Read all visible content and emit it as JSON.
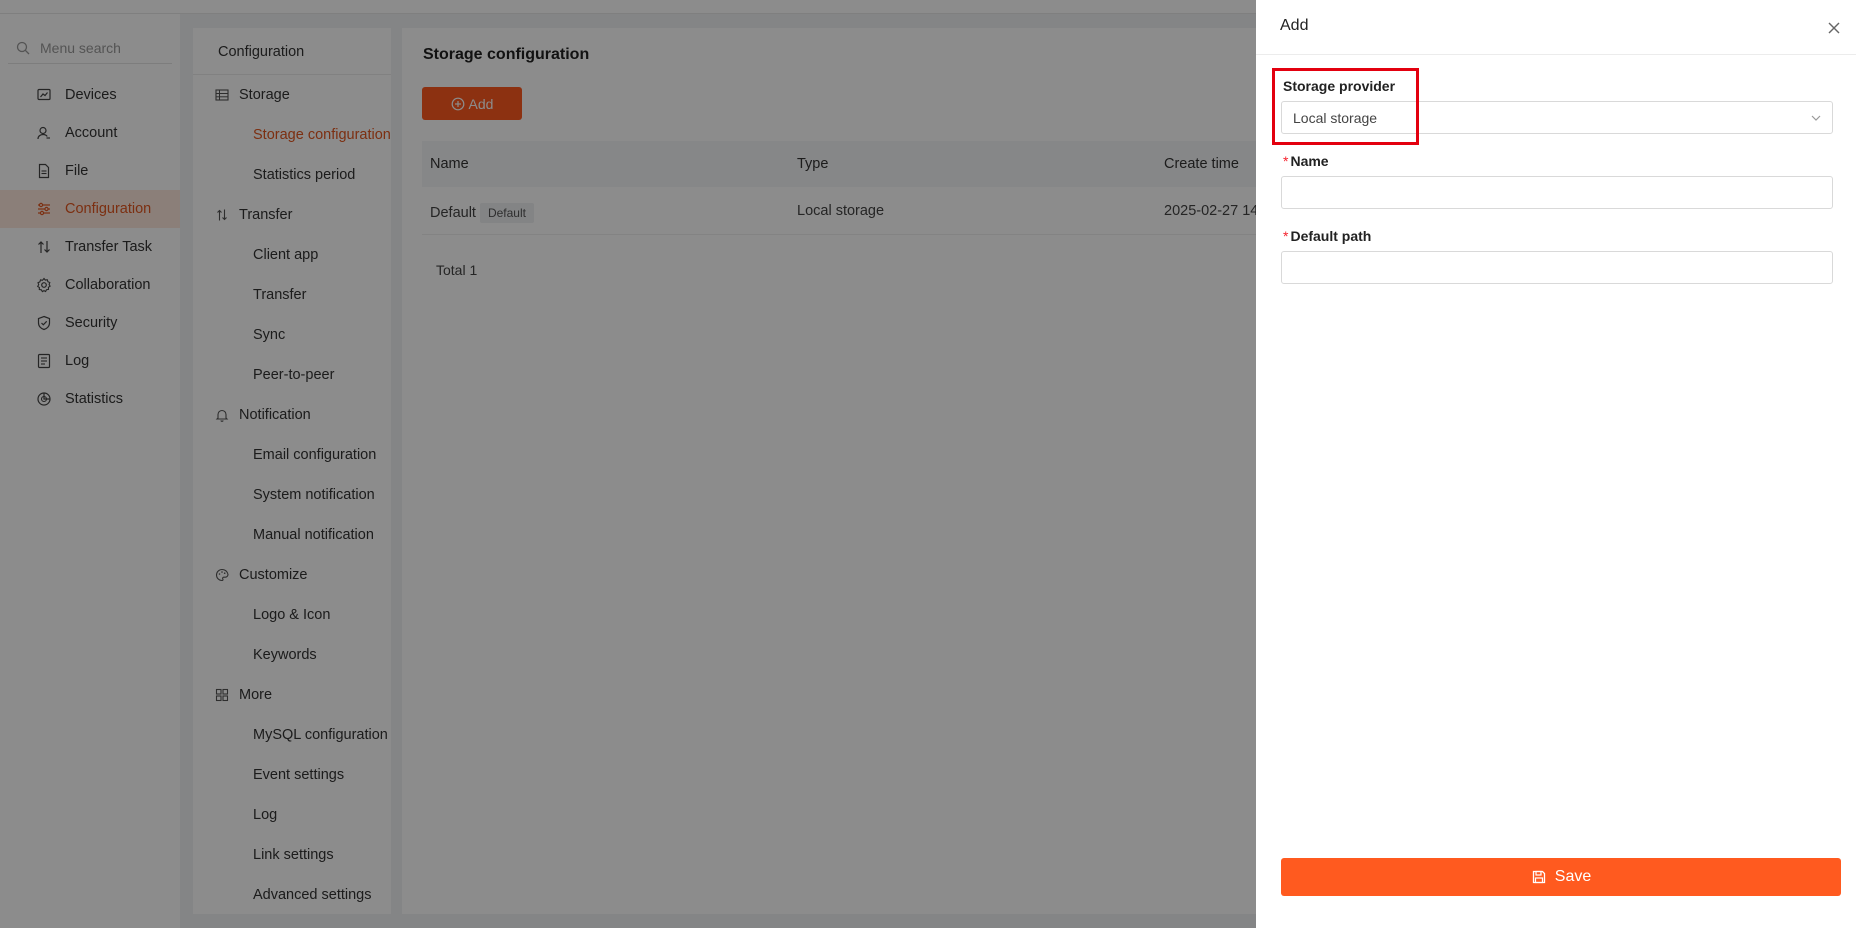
{
  "sidebar": {
    "search_placeholder": "Menu search",
    "items": [
      {
        "label": "Devices"
      },
      {
        "label": "Account"
      },
      {
        "label": "File"
      },
      {
        "label": "Configuration"
      },
      {
        "label": "Transfer Task"
      },
      {
        "label": "Collaboration"
      },
      {
        "label": "Security"
      },
      {
        "label": "Log"
      },
      {
        "label": "Statistics"
      }
    ],
    "active_item": "Configuration"
  },
  "config_menu": {
    "title": "Configuration",
    "groups": [
      {
        "label": "Storage",
        "icon": "table-icon",
        "items": [
          "Storage configuration",
          "Statistics period"
        ]
      },
      {
        "label": "Transfer",
        "icon": "transfer-icon",
        "items": [
          "Client app",
          "Transfer",
          "Sync",
          "Peer-to-peer"
        ]
      },
      {
        "label": "Notification",
        "icon": "bell-icon",
        "items": [
          "Email configuration",
          "System notification",
          "Manual notification"
        ]
      },
      {
        "label": "Customize",
        "icon": "palette-icon",
        "items": [
          "Logo & Icon",
          "Keywords"
        ]
      },
      {
        "label": "More",
        "icon": "grid-icon",
        "items": [
          "MySQL configuration",
          "Event settings",
          "Log",
          "Link settings",
          "Advanced settings"
        ]
      }
    ],
    "active_item": "Storage configuration"
  },
  "main": {
    "title": "Storage configuration",
    "add_label": "Add",
    "columns": [
      "Name",
      "Type",
      "Create time"
    ],
    "rows": [
      {
        "name": "Default",
        "tag": "Default",
        "type": "Local storage",
        "create_time": "2025-02-27 14:"
      }
    ],
    "total": "Total 1"
  },
  "drawer": {
    "title": "Add",
    "storage_provider_label": "Storage provider",
    "storage_provider_value": "Local storage",
    "name_label": "Name",
    "name_value": "",
    "default_path_label": "Default path",
    "default_path_value": "",
    "required_mark": "*",
    "save_label": "Save"
  },
  "colors": {
    "accent": "#ff5a1f",
    "active_text": "#e2561f",
    "active_bg": "#fde7dd",
    "highlight_box": "#e3000f"
  }
}
